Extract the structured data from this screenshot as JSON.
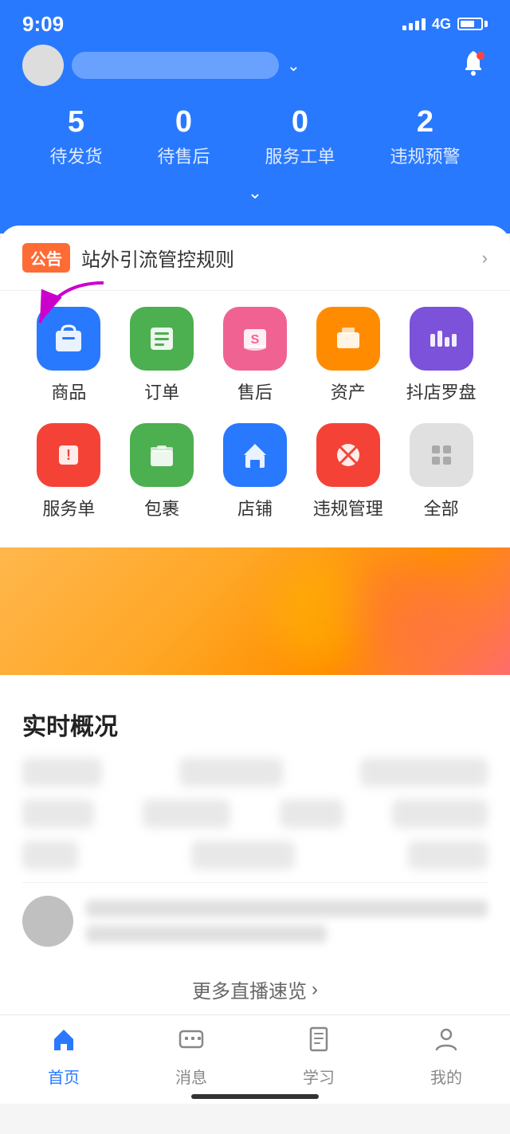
{
  "statusBar": {
    "time": "9:09",
    "network": "4G"
  },
  "header": {
    "storeName": "",
    "stats": [
      {
        "id": "pending-ship",
        "num": "5",
        "label": "待发货"
      },
      {
        "id": "pending-after",
        "num": "0",
        "label": "待售后"
      },
      {
        "id": "service-order",
        "num": "0",
        "label": "服务工单"
      },
      {
        "id": "violation",
        "num": "2",
        "label": "违规预警"
      }
    ]
  },
  "announcement": {
    "badge": "公告",
    "text": "站外引流管控规则",
    "arrowLabel": ">"
  },
  "iconGrid": {
    "row1": [
      {
        "id": "goods",
        "label": "商品",
        "colorClass": "icon-blue"
      },
      {
        "id": "orders",
        "label": "订单",
        "colorClass": "icon-green"
      },
      {
        "id": "aftersale",
        "label": "售后",
        "colorClass": "icon-pink"
      },
      {
        "id": "assets",
        "label": "资产",
        "colorClass": "icon-orange"
      },
      {
        "id": "compass",
        "label": "抖店罗盘",
        "colorClass": "icon-purple"
      }
    ],
    "row2": [
      {
        "id": "service",
        "label": "服务单",
        "colorClass": "icon-red"
      },
      {
        "id": "package",
        "label": "包裹",
        "colorClass": "icon-green2"
      },
      {
        "id": "store",
        "label": "店铺",
        "colorClass": "icon-blue2"
      },
      {
        "id": "violation-mgmt",
        "label": "违规管理",
        "colorClass": "icon-red2"
      },
      {
        "id": "all",
        "label": "全部",
        "colorClass": "icon-gray"
      }
    ]
  },
  "realtimeSection": {
    "title": "实时概况",
    "moreLive": "更多直播速览",
    "moreLiveArrow": ">"
  },
  "bottomNav": [
    {
      "id": "home",
      "label": "首页",
      "active": true
    },
    {
      "id": "message",
      "label": "消息",
      "active": false
    },
    {
      "id": "learn",
      "label": "学习",
      "active": false
    },
    {
      "id": "mine",
      "label": "我的",
      "active": false
    }
  ]
}
